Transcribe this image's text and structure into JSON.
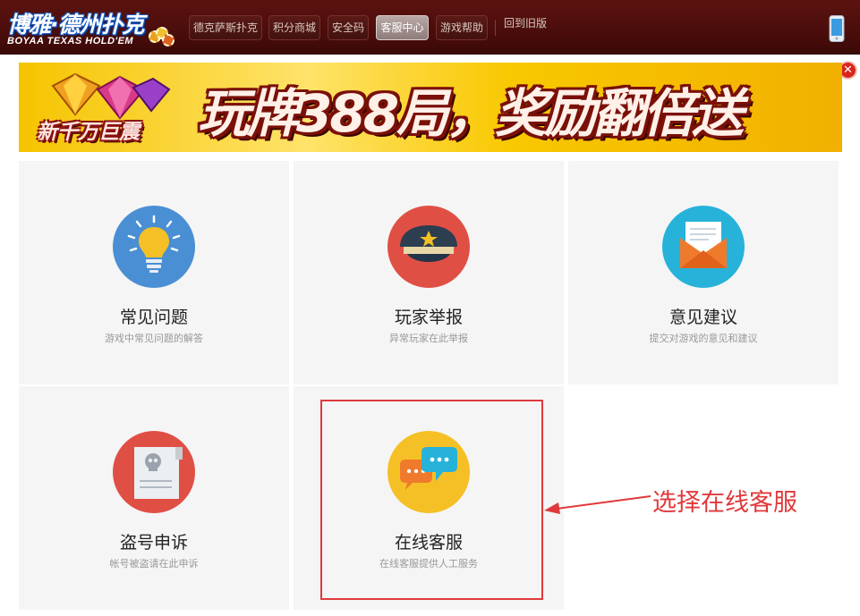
{
  "header": {
    "logo_title": "博雅·德州扑克",
    "logo_subtitle": "BOYAA TEXAS HOLD'EM",
    "tabs": [
      {
        "label": "德克萨斯扑克",
        "active": false
      },
      {
        "label": "积分商城",
        "active": false
      },
      {
        "label": "安全码",
        "active": false
      },
      {
        "label": "客服中心",
        "active": true
      },
      {
        "label": "游戏帮助",
        "active": false
      }
    ],
    "old_version_label": "回到旧版",
    "phone_icon": "mobile-phone-icon"
  },
  "close_icon": "close-icon",
  "banner": {
    "left_text": "新千万巨震",
    "main_text": "玩牌388局，奖励翻倍送"
  },
  "cards": [
    {
      "title": "常见问题",
      "desc": "游戏中常见问题的解答",
      "icon": "lightbulb-icon",
      "color": "#4a8fd4"
    },
    {
      "title": "玩家举报",
      "desc": "异常玩家在此举报",
      "icon": "police-cap-icon",
      "color": "#e04f44"
    },
    {
      "title": "意见建议",
      "desc": "提交对游戏的意见和建议",
      "icon": "envelope-icon",
      "color": "#27b2da"
    },
    {
      "title": "盗号申诉",
      "desc": "帐号被盗请在此申诉",
      "icon": "skull-document-icon",
      "color": "#e04f44"
    },
    {
      "title": "在线客服",
      "desc": "在线客服提供人工服务",
      "icon": "chat-bubbles-icon",
      "color": "#f5c025"
    }
  ],
  "annotation": {
    "text": "选择在线客服",
    "color": "#e0393b"
  }
}
